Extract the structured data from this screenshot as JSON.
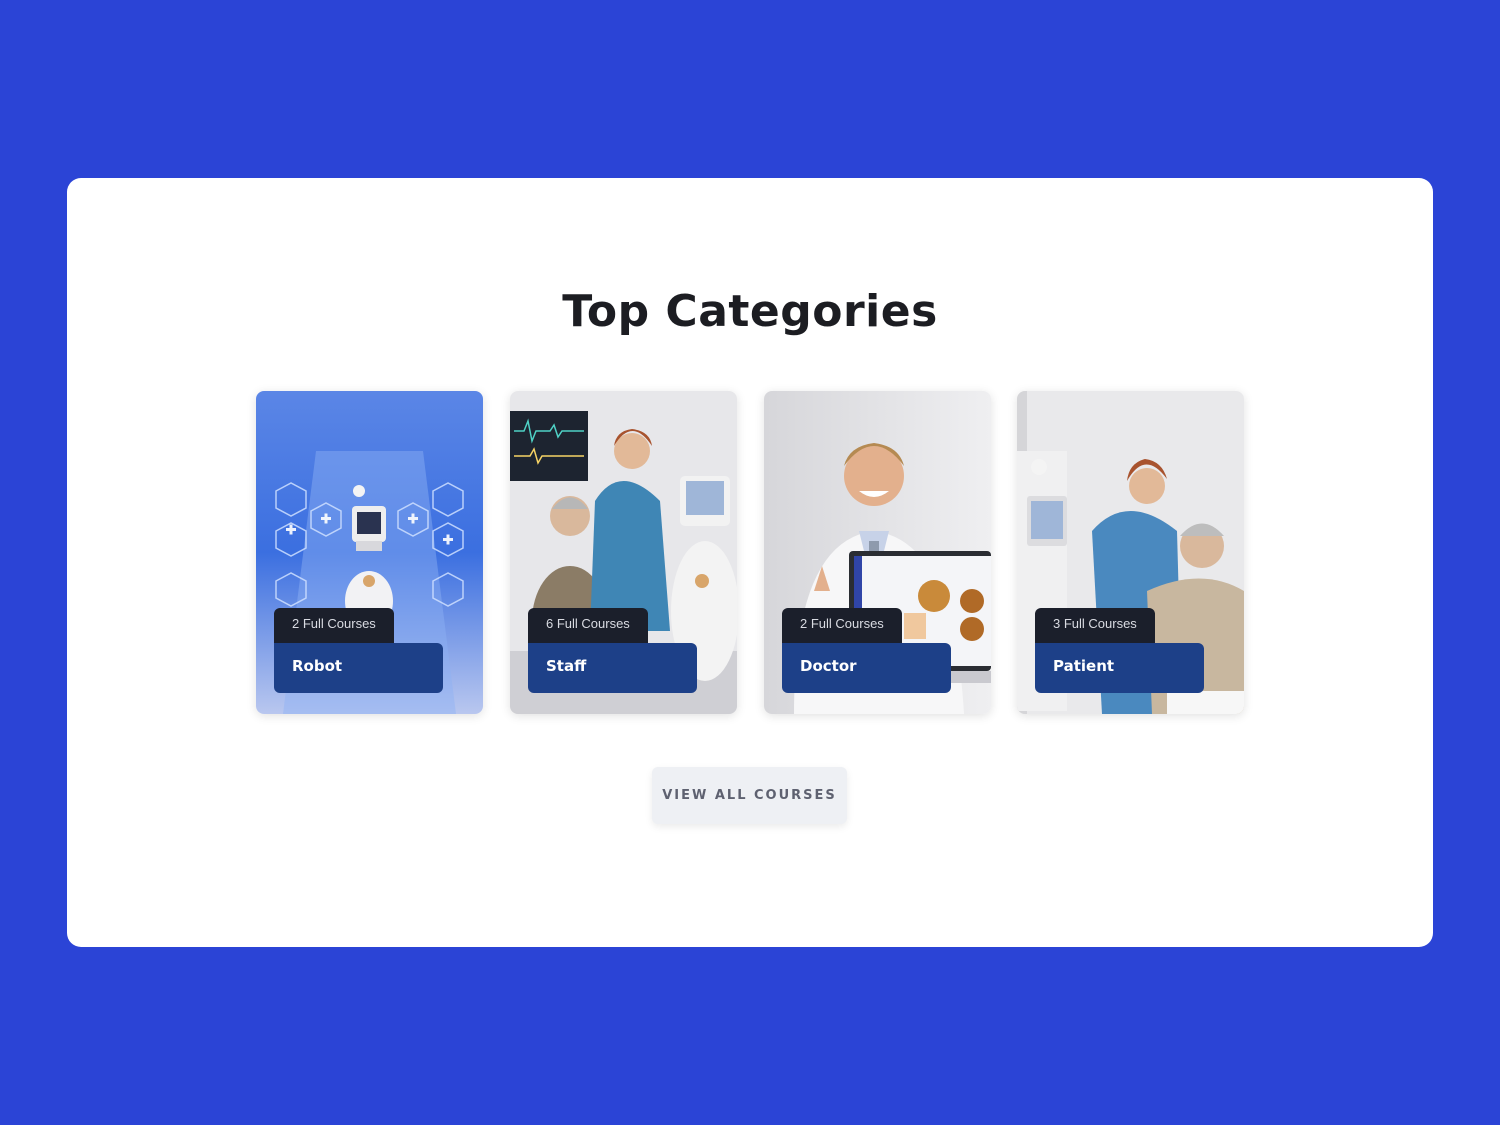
{
  "section": {
    "title": "Top Categories"
  },
  "categories": [
    {
      "name": "Robot",
      "count_label": "2 Full Courses",
      "image": "hospital-corridor-robot-photo"
    },
    {
      "name": "Staff",
      "count_label": "6 Full Courses",
      "image": "nurse-with-elderly-patient-photo"
    },
    {
      "name": "Doctor",
      "count_label": "2 Full Courses",
      "image": "doctor-with-laptop-photo"
    },
    {
      "name": "Patient",
      "count_label": "3 Full Courses",
      "image": "nurse-with-patient-photo"
    }
  ],
  "actions": {
    "view_all_label": "VIEW ALL COURSES"
  },
  "colors": {
    "page_background": "#2b44d6",
    "panel_background": "#ffffff",
    "title_text": "#1c1d22",
    "name_tab": "#1d4088",
    "count_tab": "#1b1f2b",
    "button_background": "#eef0f4"
  }
}
